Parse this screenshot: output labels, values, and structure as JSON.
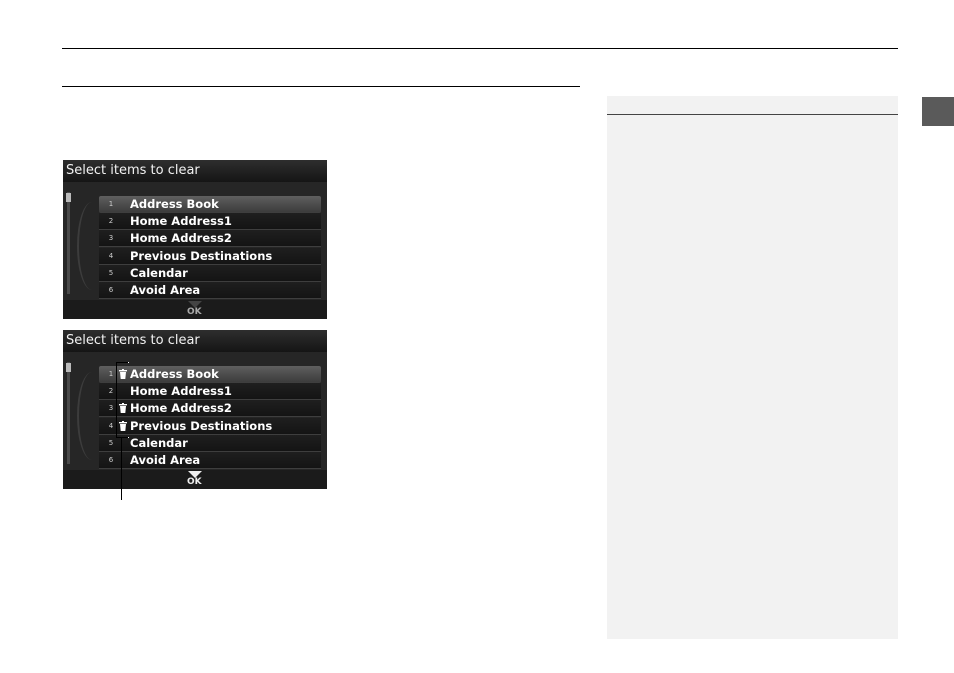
{
  "screens": [
    {
      "title": "Select items to clear",
      "ok_label": "OK",
      "ok_enabled": false,
      "items": [
        {
          "num": "1",
          "label": "Address Book",
          "checked": false
        },
        {
          "num": "2",
          "label": "Home Address1",
          "checked": false
        },
        {
          "num": "3",
          "label": "Home Address2",
          "checked": false
        },
        {
          "num": "4",
          "label": "Previous Destinations",
          "checked": false
        },
        {
          "num": "5",
          "label": "Calendar",
          "checked": false
        },
        {
          "num": "6",
          "label": "Avoid Area",
          "checked": false
        }
      ]
    },
    {
      "title": "Select items to clear",
      "ok_label": "OK",
      "ok_enabled": true,
      "items": [
        {
          "num": "1",
          "label": "Address Book",
          "checked": true
        },
        {
          "num": "2",
          "label": "Home Address1",
          "checked": false
        },
        {
          "num": "3",
          "label": "Home Address2",
          "checked": true
        },
        {
          "num": "4",
          "label": "Previous Destinations",
          "checked": true
        },
        {
          "num": "5",
          "label": "Calendar",
          "checked": false
        },
        {
          "num": "6",
          "label": "Avoid Area",
          "checked": false
        }
      ]
    }
  ],
  "icons": {
    "trash": "trash-icon",
    "ok_arrow": "triangle-down-icon"
  },
  "colors": {
    "screen_bg": "#1b1b1b",
    "sidebar_bg": "#f2f2f2",
    "side_tab": "#5a5a5a"
  }
}
